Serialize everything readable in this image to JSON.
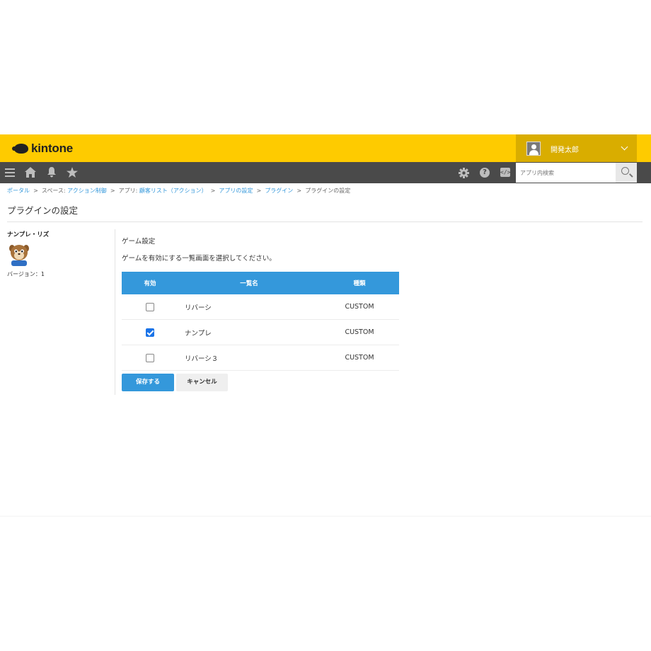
{
  "header": {
    "logo_text": "kintone",
    "user_name": "開発太郎",
    "brand_color": "#fecb00",
    "user_area_color": "#d9ad00"
  },
  "navbar": {
    "icons": [
      "menu-icon",
      "home-icon",
      "bell-icon",
      "star-icon",
      "gear-icon",
      "help-icon",
      "code-icon"
    ],
    "search_placeholder": "アプリ内検索"
  },
  "breadcrumb": [
    {
      "label": "ポータル",
      "link": true
    },
    {
      "label": "スペース: ",
      "link": false
    },
    {
      "label": "アクション制御",
      "link": true
    },
    {
      "label": "アプリ: ",
      "link": false
    },
    {
      "label": "顧客リスト（アクション）",
      "link": true
    },
    {
      "label": "アプリの設定",
      "link": true
    },
    {
      "label": "プラグイン",
      "link": true
    },
    {
      "label": "プラグインの設定",
      "link": false
    }
  ],
  "page_title": "プラグインの設定",
  "plugin": {
    "name": "ナンプレ・リズ",
    "version_label": "バージョン：1"
  },
  "settings": {
    "section_title": "ゲーム設定",
    "description": "ゲームを有効にする一覧画面を選択してください。",
    "columns": [
      "有効",
      "一覧名",
      "種類"
    ],
    "rows": [
      {
        "enabled": false,
        "name": "リバーシ",
        "type": "CUSTOM"
      },
      {
        "enabled": true,
        "name": "ナンプレ",
        "type": "CUSTOM"
      },
      {
        "enabled": false,
        "name": "リバーシ３",
        "type": "CUSTOM"
      }
    ],
    "save_label": "保存する",
    "cancel_label": "キャンセル",
    "accent_color": "#3498db"
  }
}
